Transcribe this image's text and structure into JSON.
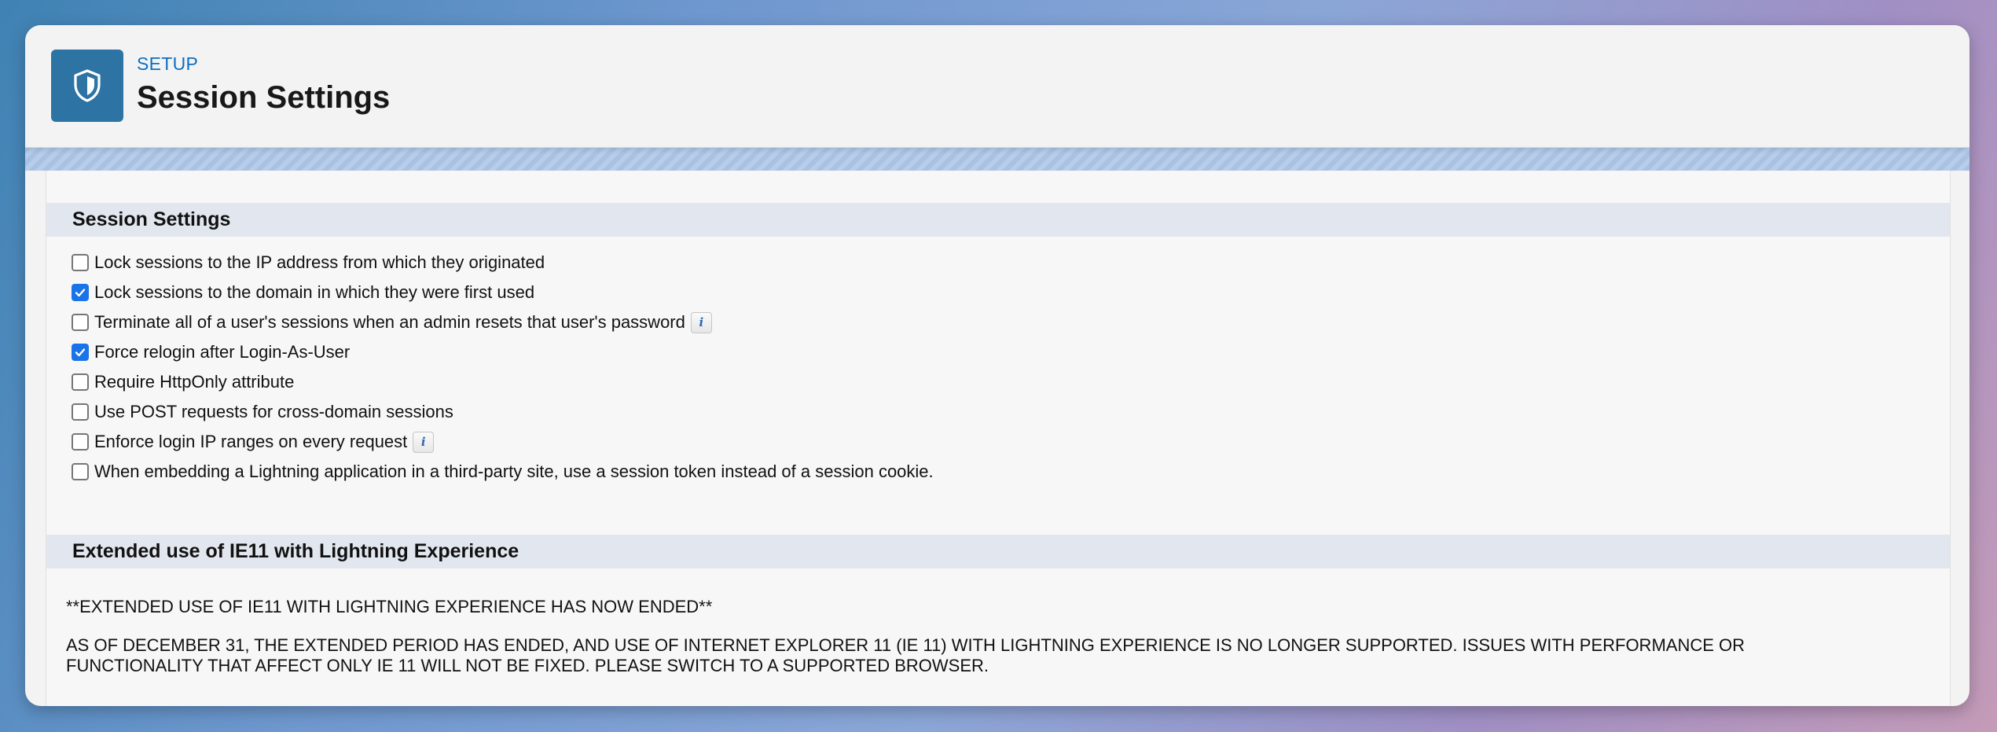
{
  "header": {
    "setup_label": "SETUP",
    "title": "Session Settings",
    "icon": "shield-icon"
  },
  "session_settings": {
    "section_title": "Session Settings",
    "options": [
      {
        "label": "Lock sessions to the IP address from which they originated",
        "checked": false,
        "info": false
      },
      {
        "label": "Lock sessions to the domain in which they were first used",
        "checked": true,
        "info": false
      },
      {
        "label": "Terminate all of a user's sessions when an admin resets that user's password",
        "checked": false,
        "info": true
      },
      {
        "label": "Force relogin after Login-As-User",
        "checked": true,
        "info": false
      },
      {
        "label": "Require HttpOnly attribute",
        "checked": false,
        "info": false
      },
      {
        "label": "Use POST requests for cross-domain sessions",
        "checked": false,
        "info": false
      },
      {
        "label": "Enforce login IP ranges on every request",
        "checked": false,
        "info": true
      },
      {
        "label": "When embedding a Lightning application in a third-party site, use a session token instead of a session cookie.",
        "checked": false,
        "info": false
      }
    ],
    "info_glyph": "i"
  },
  "ie11": {
    "section_title": "Extended use of IE11 with Lightning Experience",
    "notice": "**EXTENDED USE OF IE11 WITH LIGHTNING EXPERIENCE HAS NOW ENDED**",
    "body_line1": "AS OF DECEMBER 31, THE EXTENDED PERIOD HAS ENDED, AND USE OF INTERNET EXPLORER 11 (IE 11) WITH LIGHTNING EXPERIENCE IS NO LONGER SUPPORTED. ISSUES WITH PERFORMANCE OR",
    "body_line2": "FUNCTIONALITY THAT AFFECT ONLY IE 11 WILL NOT BE FIXED. PLEASE SWITCH TO A SUPPORTED BROWSER."
  },
  "colors": {
    "accent": "#0b6fc4",
    "icon_bg": "#2d73a4",
    "checkbox_checked": "#1a73e8",
    "section_header_bg": "#e2e7ef"
  }
}
